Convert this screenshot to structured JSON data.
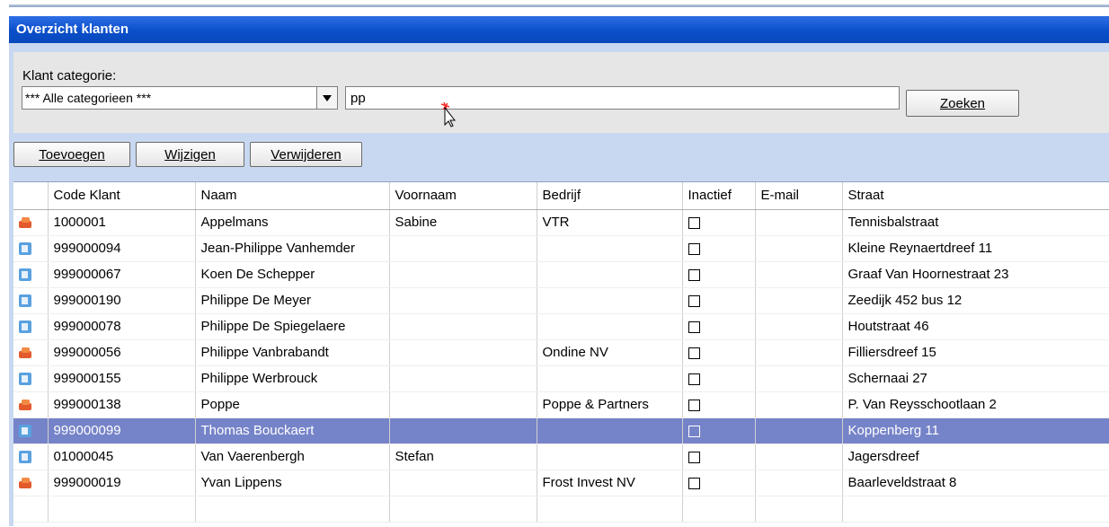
{
  "window": {
    "title": "Overzicht klanten"
  },
  "filter": {
    "category_label": "Klant categorie:",
    "category_value": "*** Alle categorieen ***",
    "search_value": "pp",
    "search_button": "Zoeken"
  },
  "toolbar": {
    "add": "Toevoegen",
    "edit": "Wijzigen",
    "delete": "Verwijderen"
  },
  "table": {
    "columns": [
      "",
      "Code Klant",
      "Naam",
      "Voornaam",
      "Bedrijf",
      "Inactief",
      "E-mail",
      "Straat"
    ],
    "rows": [
      {
        "icon": "company-icon",
        "code": "1000001",
        "naam": "Appelmans",
        "voornaam": "Sabine",
        "bedrijf": "VTR",
        "inactief": false,
        "email": "",
        "straat": "Tennisbalstraat"
      },
      {
        "icon": "person-icon",
        "code": "999000094",
        "naam": "Jean-Philippe Vanhemder",
        "voornaam": "",
        "bedrijf": "",
        "inactief": false,
        "email": "",
        "straat": "Kleine Reynaertdreef 11"
      },
      {
        "icon": "person-icon",
        "code": "999000067",
        "naam": "Koen De Schepper",
        "voornaam": "",
        "bedrijf": "",
        "inactief": false,
        "email": "",
        "straat": "Graaf Van Hoornestraat 23"
      },
      {
        "icon": "person-icon",
        "code": "999000190",
        "naam": "Philippe De Meyer",
        "voornaam": "",
        "bedrijf": "",
        "inactief": false,
        "email": "",
        "straat": "Zeedijk 452 bus 12"
      },
      {
        "icon": "person-icon",
        "code": "999000078",
        "naam": "Philippe De Spiegelaere",
        "voornaam": "",
        "bedrijf": "",
        "inactief": false,
        "email": "",
        "straat": "Houtstraat 46"
      },
      {
        "icon": "company-icon",
        "code": "999000056",
        "naam": "Philippe Vanbrabandt",
        "voornaam": "",
        "bedrijf": "Ondine NV",
        "inactief": false,
        "email": "",
        "straat": "Filliersdreef 15"
      },
      {
        "icon": "person-icon",
        "code": "999000155",
        "naam": "Philippe Werbrouck",
        "voornaam": "",
        "bedrijf": "",
        "inactief": false,
        "email": "",
        "straat": "Schernaai 27"
      },
      {
        "icon": "company-icon",
        "code": "999000138",
        "naam": "Poppe",
        "voornaam": "",
        "bedrijf": "Poppe & Partners",
        "inactief": false,
        "email": "",
        "straat": "P. Van Reysschootlaan 2"
      },
      {
        "icon": "person-icon",
        "code": "999000099",
        "naam": "Thomas Bouckaert",
        "voornaam": "",
        "bedrijf": "",
        "inactief": false,
        "email": "",
        "straat": "Koppenberg 11",
        "selected": true
      },
      {
        "icon": "person-icon",
        "code": "01000045",
        "naam": "Van Vaerenbergh",
        "voornaam": "Stefan",
        "bedrijf": "",
        "inactief": false,
        "email": "",
        "straat": "Jagersdreef"
      },
      {
        "icon": "company-icon",
        "code": "999000019",
        "naam": "Yvan Lippens",
        "voornaam": "",
        "bedrijf": "Frost Invest NV",
        "inactief": false,
        "email": "",
        "straat": "Baarleveldstraat 8"
      }
    ]
  },
  "colors": {
    "title_bar": "#0a4fc9",
    "selected_row": "#7583c8",
    "panel_background": "#c8d8f0"
  }
}
